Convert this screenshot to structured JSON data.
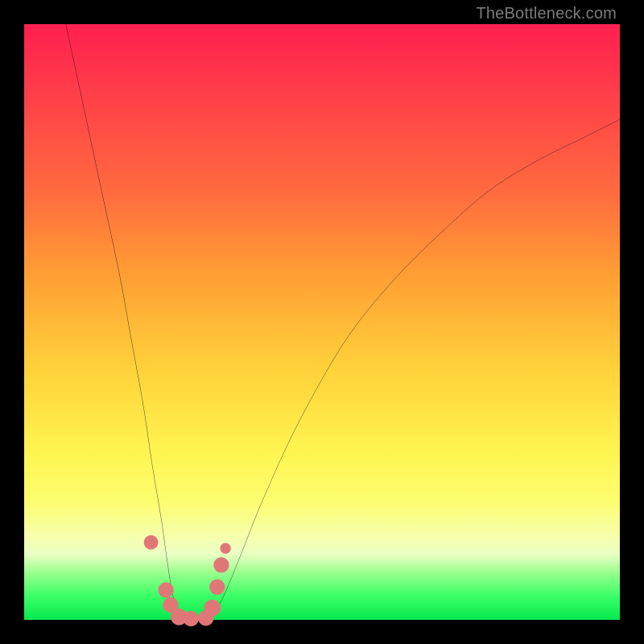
{
  "watermark": {
    "text": "TheBottleneck.com"
  },
  "chart_data": {
    "type": "line",
    "title": "",
    "xlabel": "",
    "ylabel": "",
    "xlim": [
      0,
      100
    ],
    "ylim": [
      0,
      100
    ],
    "grid": false,
    "legend": false,
    "annotations": [],
    "series": [
      {
        "name": "bottleneck-curve",
        "color": "#000000",
        "x": [
          7,
          10,
          13,
          16,
          18,
          20,
          21.5,
          23,
          24,
          25,
          26.5,
          29,
          31,
          33,
          36,
          40,
          46,
          54,
          62,
          70,
          78,
          86,
          94,
          100
        ],
        "y": [
          100,
          86,
          72,
          58,
          47,
          36,
          26,
          17,
          10,
          4,
          0.5,
          0,
          0.5,
          3,
          10,
          20,
          33,
          47,
          57,
          65,
          72,
          77,
          81,
          84
        ]
      }
    ],
    "markers": [
      {
        "name": "dot",
        "x": 21.3,
        "y": 13.0,
        "r": 1.2,
        "color": "#e17677"
      },
      {
        "name": "dot",
        "x": 23.8,
        "y": 5.0,
        "r": 1.3,
        "color": "#e17677"
      },
      {
        "name": "dot",
        "x": 24.6,
        "y": 2.5,
        "r": 1.3,
        "color": "#e17677"
      },
      {
        "name": "dot",
        "x": 26.0,
        "y": 0.5,
        "r": 1.4,
        "color": "#e17677"
      },
      {
        "name": "dot",
        "x": 28.0,
        "y": 0.2,
        "r": 1.3,
        "color": "#e17677"
      },
      {
        "name": "dot",
        "x": 30.5,
        "y": 0.3,
        "r": 1.3,
        "color": "#e17677"
      },
      {
        "name": "dot",
        "x": 31.6,
        "y": 2.0,
        "r": 1.4,
        "color": "#e17677"
      },
      {
        "name": "dot",
        "x": 32.4,
        "y": 5.5,
        "r": 1.3,
        "color": "#e17677"
      },
      {
        "name": "dot",
        "x": 33.1,
        "y": 9.2,
        "r": 1.3,
        "color": "#e17677"
      },
      {
        "name": "dot",
        "x": 33.8,
        "y": 12.0,
        "r": 0.9,
        "color": "#e17677"
      }
    ]
  }
}
